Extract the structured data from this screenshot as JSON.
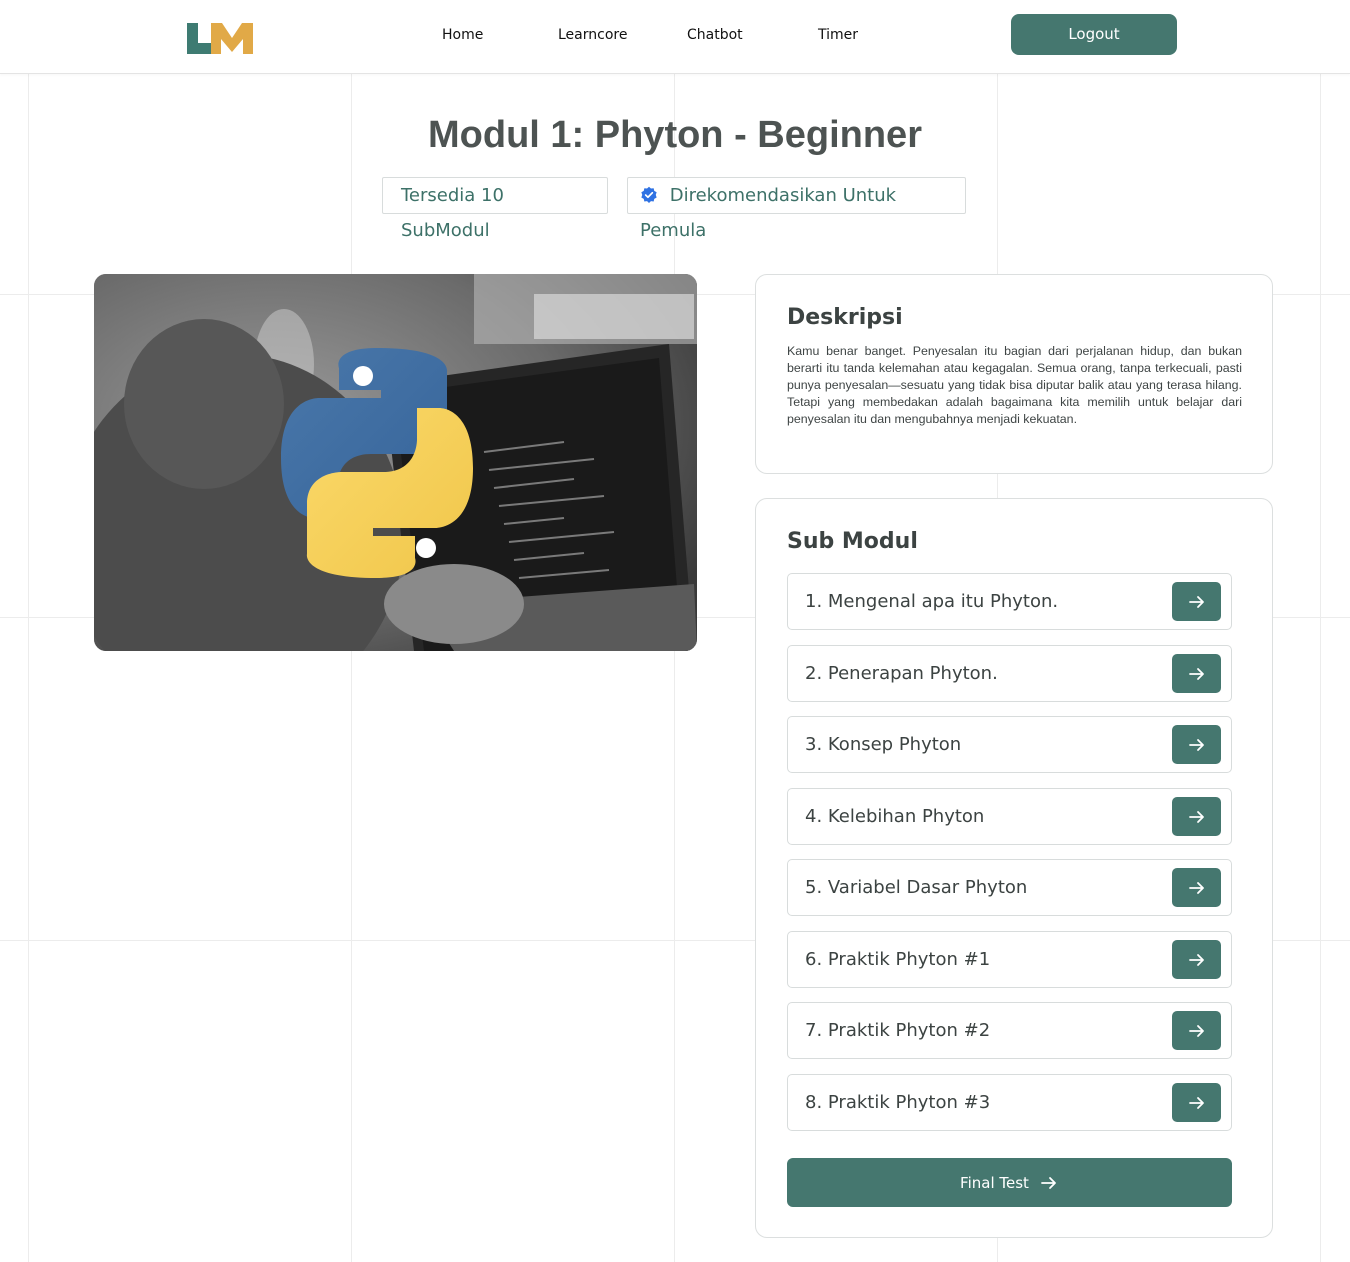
{
  "header": {
    "logo_text": "LM",
    "nav": [
      {
        "label": "Home"
      },
      {
        "label": "Learncore"
      },
      {
        "label": "Chatbot"
      },
      {
        "label": "Timer"
      }
    ],
    "logout_label": "Logout"
  },
  "module": {
    "title": "Modul 1: Phyton - Beginner",
    "chip_submodules": "Tersedia 10 SubModul",
    "chip_recommended": "Direkomendasikan Untuk Pemula"
  },
  "description": {
    "heading": "Deskripsi",
    "text": "Kamu benar banget. Penyesalan itu bagian dari perjalanan hidup, dan bukan berarti itu tanda kelemahan atau kegagalan. Semua orang, tanpa terkecuali, pasti punya penyesalan—sesuatu yang tidak bisa diputar balik atau yang terasa hilang. Tetapi yang membedakan adalah bagaimana kita memilih untuk belajar dari penyesalan itu dan mengubahnya menjadi kekuatan."
  },
  "submodules": {
    "heading": "Sub Modul",
    "items": [
      {
        "label": "1. Mengenal apa itu Phyton."
      },
      {
        "label": "2. Penerapan Phyton."
      },
      {
        "label": "3. Konsep Phyton"
      },
      {
        "label": "4. Kelebihan Phyton"
      },
      {
        "label": "5. Variabel Dasar Phyton"
      },
      {
        "label": "6. Praktik Phyton #1"
      },
      {
        "label": "7. Praktik Phyton #2"
      },
      {
        "label": "8. Praktik Phyton #3"
      }
    ],
    "final_test_label": "Final Test"
  },
  "colors": {
    "primary": "#45776f",
    "logo_green": "#3e7b72",
    "logo_gold": "#e1a947",
    "python_blue": "#3f6ea0",
    "python_yellow": "#f5cd57",
    "verified_blue": "#2f72e3"
  }
}
